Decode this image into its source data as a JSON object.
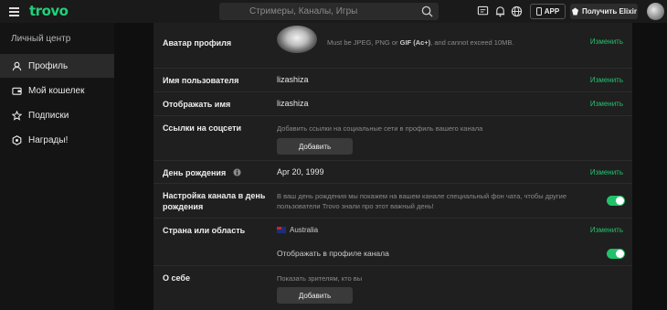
{
  "topbar": {
    "logo": "trovo",
    "search_placeholder": "Стримеры, Каналы, Игры",
    "app_label": "APP",
    "elixir_label": "Получить Elixir"
  },
  "sidebar": {
    "title": "Личный центр",
    "items": [
      {
        "label": "Профиль",
        "icon": "user-icon",
        "active": true
      },
      {
        "label": "Мой кошелек",
        "icon": "wallet-icon",
        "active": false
      },
      {
        "label": "Подписки",
        "icon": "star-icon",
        "active": false
      },
      {
        "label": "Награды!",
        "icon": "hexagon-icon",
        "active": false
      }
    ]
  },
  "profile": {
    "edit_label": "Изменить",
    "avatar": {
      "label": "Аватар профиля",
      "hint_prefix": "Must be JPEG, PNG or ",
      "hint_bold": "GIF (Ac+)",
      "hint_suffix": ", and cannot exceed 10MB."
    },
    "username": {
      "label": "Имя пользователя",
      "value": "lizashiza"
    },
    "display_name": {
      "label": "Отображать имя",
      "value": "lizashiza"
    },
    "social": {
      "label": "Ссылки на соцсети",
      "hint": "Добавить ссылки на социальные сети в профиль вашего канала",
      "button": "Добавить"
    },
    "birthday": {
      "label": "День рождения",
      "value": "Apr 20, 1999"
    },
    "birthday_channel": {
      "label": "Настройка канала в день рождения",
      "hint": "В ваш день рождения мы покажем на вашем канале специальный фон чата, чтобы другие пользователи Trovo знали про этот важный день!",
      "enabled": true
    },
    "country": {
      "label": "Страна или область",
      "value": "Australia",
      "show_label": "Отображать в профиле канала",
      "show_enabled": true
    },
    "about": {
      "label": "О себе",
      "hint": "Показать зрителям, кто вы",
      "button": "Добавить"
    }
  },
  "colors": {
    "accent": "#25c16f",
    "panel": "#1f1f1f",
    "background": "#0f0f0f"
  }
}
